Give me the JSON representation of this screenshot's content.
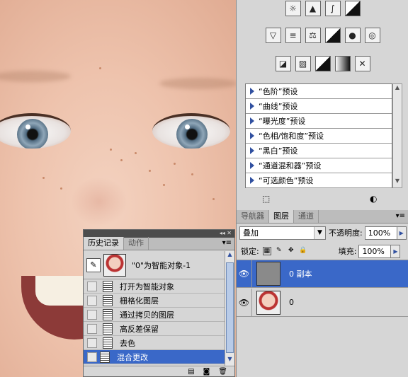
{
  "adjustments": {
    "icons_row1": [
      "brightness-icon",
      "levels-icon",
      "curves-icon",
      "exposure-icon"
    ],
    "icons_row2": [
      "vibrance-icon",
      "hue-saturation-icon",
      "color-balance-icon",
      "black-white-icon",
      "photo-filter-icon",
      "channel-mixer-icon"
    ],
    "icons_row3": [
      "invert-icon",
      "posterize-icon",
      "threshold-icon",
      "gradient-map-icon",
      "selective-color-icon"
    ],
    "presets": [
      "“色阶”预设",
      "“曲线”预设",
      "“曝光度”预设",
      "“色相/饱和度”预设",
      "“黑白”预设",
      "“通道混和器”预设",
      "“可选颜色”预设"
    ]
  },
  "layers_panel": {
    "tabs": [
      "导航器",
      "图层",
      "通道"
    ],
    "blend_mode": "叠加",
    "opacity_label": "不透明度:",
    "opacity_value": "100%",
    "lock_label": "锁定:",
    "fill_label": "填充:",
    "fill_value": "100%",
    "layers": [
      {
        "name": "0 副本",
        "selected": true,
        "thumb": "gray"
      },
      {
        "name": "0",
        "selected": false,
        "thumb": "photo"
      }
    ]
  },
  "history_panel": {
    "tabs": [
      "历史记录",
      "动作"
    ],
    "snapshot_label": "\"0\"为智能对象-1",
    "steps": [
      {
        "label": "打开为智能对象",
        "selected": false
      },
      {
        "label": "栅格化图层",
        "selected": false
      },
      {
        "label": "通过拷贝的图层",
        "selected": false
      },
      {
        "label": "高反差保留",
        "selected": false
      },
      {
        "label": "去色",
        "selected": false
      },
      {
        "label": "混合更改",
        "selected": true
      }
    ]
  },
  "colors": {
    "selection": "#3a68c8",
    "panel_bg": "#d6d6d6",
    "preset_arrow": "#3050a0"
  }
}
